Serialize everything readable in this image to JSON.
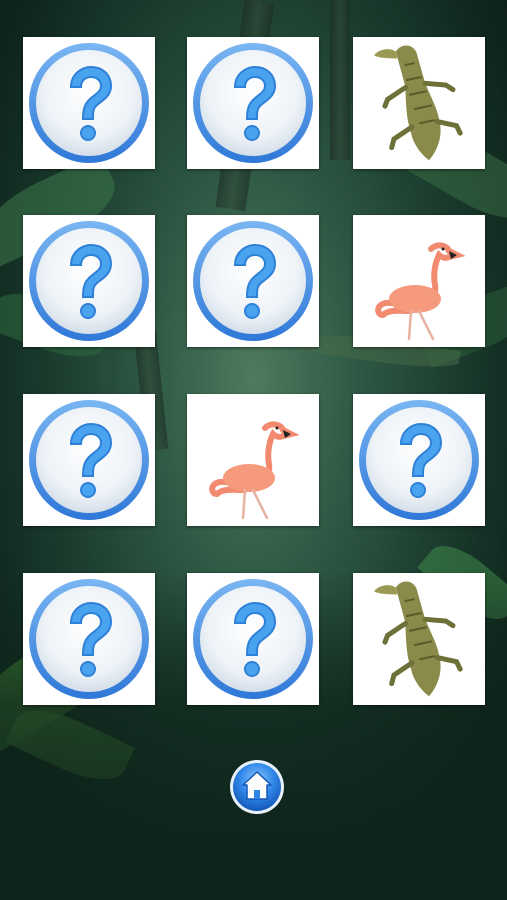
{
  "game": {
    "title": "",
    "cards": [
      {
        "state": "hidden",
        "face": "question-mark"
      },
      {
        "state": "hidden",
        "face": "question-mark"
      },
      {
        "state": "revealed",
        "face": "crocodile"
      },
      {
        "state": "hidden",
        "face": "question-mark"
      },
      {
        "state": "hidden",
        "face": "question-mark"
      },
      {
        "state": "revealed",
        "face": "flamingo"
      },
      {
        "state": "hidden",
        "face": "question-mark"
      },
      {
        "state": "revealed",
        "face": "flamingo"
      },
      {
        "state": "hidden",
        "face": "question-mark"
      },
      {
        "state": "hidden",
        "face": "question-mark"
      },
      {
        "state": "hidden",
        "face": "question-mark"
      },
      {
        "state": "revealed",
        "face": "crocodile"
      }
    ]
  },
  "home_button": {
    "icon": "home-icon"
  },
  "colors": {
    "card_bg": "#ffffff",
    "question_ring": "#4a90e2",
    "question_mark": "#4aa3ee",
    "background": "#1c3d2f"
  }
}
